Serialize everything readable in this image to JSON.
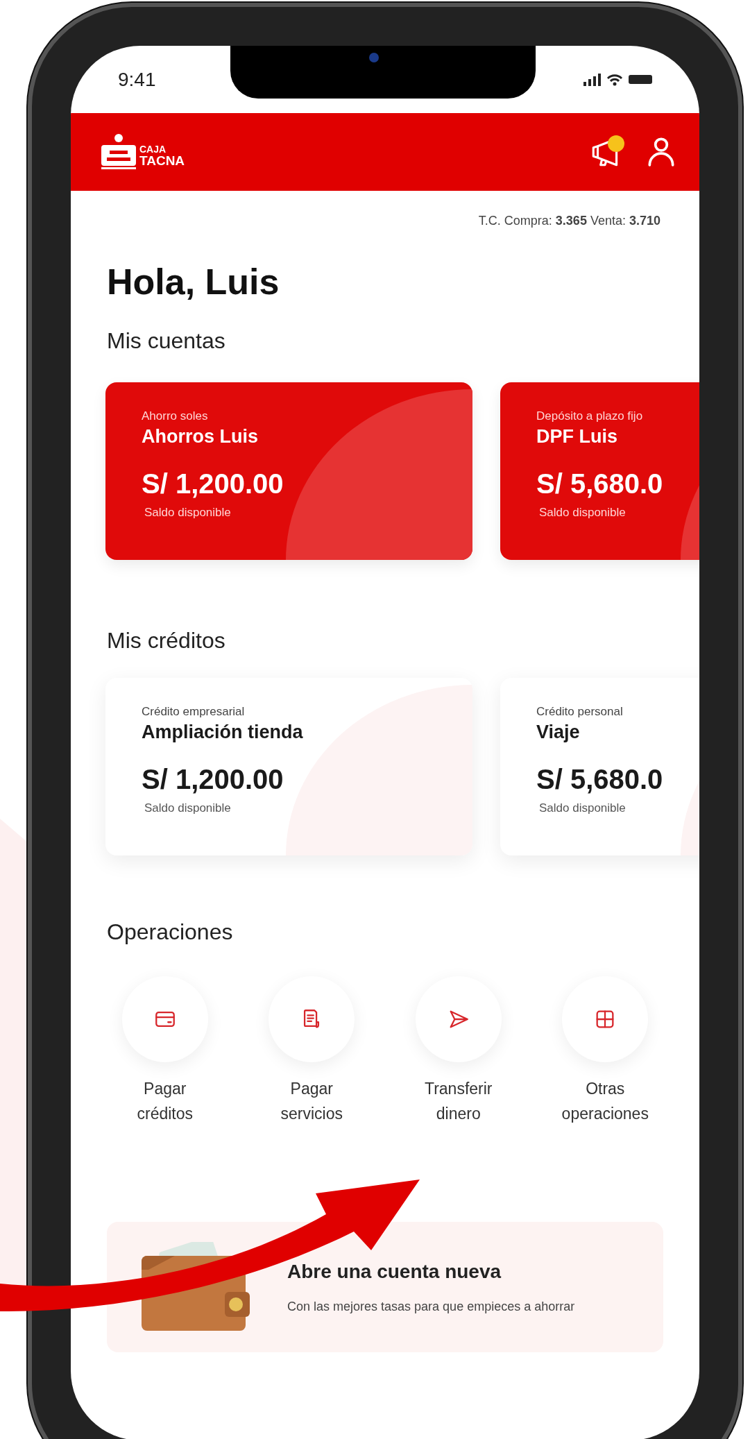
{
  "status_bar": {
    "time": "9:41"
  },
  "header": {
    "logo": {
      "line1": "CAJA",
      "line2": "TACNA"
    },
    "has_notification": true
  },
  "exchange_rate": "T.C.  Compra: **3.365** Venta: **3.710**",
  "greeting": "Hola, Luis",
  "accounts": {
    "title": "Mis cuentas",
    "items": [
      {
        "type": "Ahorro soles",
        "name": "Ahorros Luis",
        "amount": "S/ 1,200.00",
        "caption": "Saldo disponible"
      },
      {
        "type": "Depósito a plazo fijo",
        "name": "DPF Luis",
        "amount": "S/ 5,680.0",
        "caption": "Saldo disponible"
      }
    ]
  },
  "credits": {
    "title": "Mis créditos",
    "items": [
      {
        "type": "Crédito empresarial",
        "name": "Ampliación tienda",
        "amount": "S/ 1,200.00",
        "caption": "Saldo disponible"
      },
      {
        "type": "Crédito personal",
        "name": "Viaje",
        "amount": "S/ 5,680.0",
        "caption": "Saldo disponible"
      }
    ]
  },
  "operations": {
    "title": "Operaciones",
    "items": [
      {
        "kind": "card",
        "line1": "Pagar",
        "line2": "créditos"
      },
      {
        "kind": "receipt",
        "line1": "Pagar",
        "line2": "servicios"
      },
      {
        "kind": "send",
        "line1": "Transferir",
        "line2": "dinero"
      },
      {
        "kind": "grid",
        "line1": "Otras",
        "line2": "operaciones"
      }
    ]
  },
  "promo": {
    "title": "Abre una cuenta nueva",
    "text": "Con las mejores tasas para que empieces a ahorrar"
  }
}
